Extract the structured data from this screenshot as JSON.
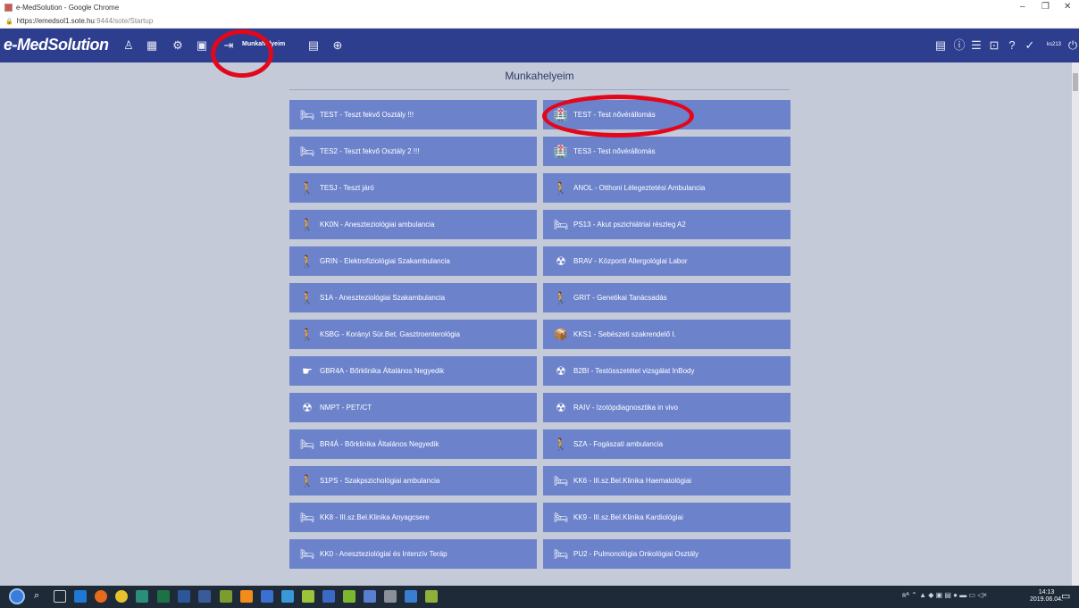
{
  "window": {
    "title": "e-MedSolution - Google Chrome",
    "url_host": "https://emedsol1.sote.hu",
    "url_path": ":9444/sote/Startup"
  },
  "app": {
    "logo": "e-MedSolution",
    "nav_active_label": "Munkahelyeim",
    "user": "ks213"
  },
  "page": {
    "title": "Munkahelyeim"
  },
  "tiles": [
    {
      "label": "TEST - Teszt fekvő Osztály !!!",
      "icon": "bed-icon",
      "glyph": "🛏"
    },
    {
      "label": "TEST - Test nővérállomás",
      "icon": "nurse-station-icon",
      "glyph": "🏥"
    },
    {
      "label": "TES2 - Teszt fekvő Osztály 2 !!!",
      "icon": "bed-icon",
      "glyph": "🛏"
    },
    {
      "label": "TES3 - Test nővérállomás",
      "icon": "nurse-station-icon",
      "glyph": "🏥"
    },
    {
      "label": "TESJ - Teszt járó",
      "icon": "person-icon",
      "glyph": "🚶"
    },
    {
      "label": "ANOL - Otthoni Lélegeztetési Ambulancia",
      "icon": "person-icon",
      "glyph": "🚶"
    },
    {
      "label": "KK0N - Aneszteziológiai ambulancia",
      "icon": "person-icon",
      "glyph": "🚶"
    },
    {
      "label": "PS13 - Akut pszichiátriai részleg A2",
      "icon": "bed-icon",
      "glyph": "🛏"
    },
    {
      "label": "GRIN - Elektrofiziológiai Szakambulancia",
      "icon": "person-icon",
      "glyph": "🚶"
    },
    {
      "label": "BRAV - Központi Allergológiai Labor",
      "icon": "lab-icon",
      "glyph": "☢"
    },
    {
      "label": "S1A - Aneszteziológiai Szakambulancia",
      "icon": "person-icon",
      "glyph": "🚶"
    },
    {
      "label": "GRIT - Genetikai Tanácsadás",
      "icon": "person-icon",
      "glyph": "🚶"
    },
    {
      "label": "KSBG - Korányi Sür.Bet. Gasztroenterológia",
      "icon": "person-icon",
      "glyph": "🚶"
    },
    {
      "label": "KKS1 - Sebészeti szakrendelő I.",
      "icon": "box-icon",
      "glyph": "📦"
    },
    {
      "label": "GBR4A - Bőrklinika Általános Negyedik",
      "icon": "pointing-hand-icon",
      "glyph": "☛"
    },
    {
      "label": "B2BI - Testösszetétel vizsgálat InBody",
      "icon": "lab-icon",
      "glyph": "☢"
    },
    {
      "label": "NMPT - PET/CT",
      "icon": "lab-icon",
      "glyph": "☢"
    },
    {
      "label": "RAIV - Izotópdiagnosztika in vivo",
      "icon": "lab-icon",
      "glyph": "☢"
    },
    {
      "label": "BR4Á - Bőrklinika Általános Negyedik",
      "icon": "bed-icon",
      "glyph": "🛏"
    },
    {
      "label": "SZA - Fogászati ambulancia",
      "icon": "person-icon",
      "glyph": "🚶"
    },
    {
      "label": "S1PS - Szakpszichológiai ambulancia",
      "icon": "person-icon",
      "glyph": "🚶"
    },
    {
      "label": "KK6 - III.sz.Bel.Klinika Haematológiai",
      "icon": "bed-icon",
      "glyph": "🛏"
    },
    {
      "label": "KK8 - III.sz.Bel.Klinika Anyagcsere",
      "icon": "bed-icon",
      "glyph": "🛏"
    },
    {
      "label": "KK9 - III.sz.Bel.Klinika Kardiológiai",
      "icon": "bed-icon",
      "glyph": "🛏"
    },
    {
      "label": "KK0 - Aneszteziológiai és Intenzív Teráp",
      "icon": "bed-icon",
      "glyph": "🛏"
    },
    {
      "label": "PU2 - Pulmonológia Onkológiai Osztály",
      "icon": "bed-icon",
      "glyph": "🛏"
    }
  ],
  "taskbar": {
    "time": "14:13",
    "date": "2019.06.04."
  },
  "colors": {
    "appbar": "#2d3e8f",
    "tile": "#6c83cc",
    "background": "#c5cad8",
    "highlight_ring": "#e2071b"
  }
}
